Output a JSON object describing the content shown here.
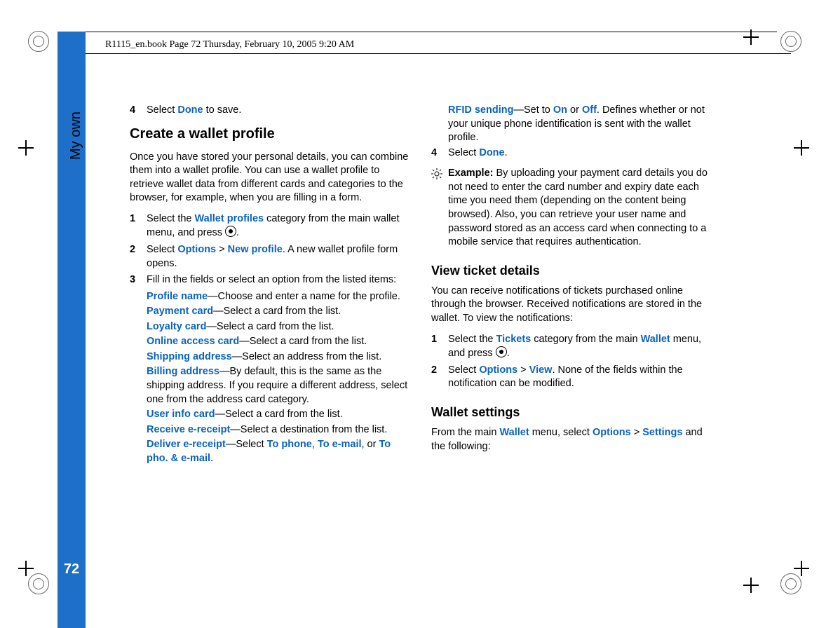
{
  "meta": {
    "header": "R1115_en.book  Page 72  Thursday, February 10, 2005  9:20 AM",
    "sideLabel": "My own",
    "pageNumber": "72"
  },
  "left": {
    "s4": {
      "num": "4",
      "pre": "Select ",
      "term": "Done",
      "post": " to save."
    },
    "h3": "Create a wallet profile",
    "intro": "Once you have stored your personal details, you can combine them into a wallet profile. You can use a wallet profile to retrieve wallet data from different cards and categories to the browser, for example, when you are filling in a form.",
    "steps": {
      "1": {
        "num": "1",
        "pre": "Select the ",
        "term": "Wallet profiles",
        "post": " category from the main wallet menu, and press "
      },
      "2": {
        "num": "2",
        "pre": "Select ",
        "t1": "Options",
        "sep": " > ",
        "t2": "New profile",
        "post": ". A new wallet profile form opens."
      },
      "3": {
        "num": "3",
        "text": "Fill in the fields or select an option from the listed items:"
      }
    },
    "defs": {
      "profileName": {
        "term": "Profile name",
        "desc": "—Choose and enter a name for the profile."
      },
      "payment": {
        "term": "Payment card",
        "desc": "—Select a card from the list."
      },
      "loyalty": {
        "term": "Loyalty card",
        "desc": "—Select a card from the list."
      },
      "online": {
        "term": "Online access card",
        "desc": "—Select a card from the list."
      },
      "shipping": {
        "term": "Shipping address",
        "desc": "—Select an address from the list."
      },
      "billing": {
        "term": "Billing address",
        "desc": "—By default, this is the same as the shipping address. If you require a different address, select one from the address card category."
      },
      "userinfo": {
        "term": "User info card",
        "desc": "—Select a card from the list."
      },
      "recvE": {
        "term": "Receive e-receipt",
        "desc": "—Select a destination from the list."
      },
      "delivE": {
        "term": "Deliver e-receipt",
        "pre": "—Select ",
        "o1": "To phone",
        "c1": ", ",
        "o2": "To e-mail",
        "c2": ", or ",
        "o3": "To pho. & e-mail",
        "post": "."
      }
    }
  },
  "right": {
    "rfid": {
      "term": "RFID sending",
      "pre": "—Set to ",
      "on": "On",
      "or": " or ",
      "off": "Off",
      "post": ". Defines whether or not your unique phone identification is sent with the wallet profile."
    },
    "s4": {
      "num": "4",
      "pre": "Select ",
      "term": "Done",
      "post": "."
    },
    "example": {
      "label": "Example:",
      "text": " By uploading your payment card details you do not need to enter the card number and expiry date each time you need them (depending on the content being browsed). Also, you can retrieve your user name and password stored as an access card when connecting to a mobile service that requires authentication."
    },
    "h4a": "View ticket details",
    "ticketsIntro": "You can receive notifications of tickets purchased online through the browser. Received notifications are stored in the wallet. To view the notifications:",
    "tsteps": {
      "1": {
        "num": "1",
        "pre": "Select the ",
        "t1": "Tickets",
        "mid": " category from the main ",
        "t2": "Wallet",
        "post": " menu, and press "
      },
      "2": {
        "num": "2",
        "pre": "Select ",
        "t1": "Options",
        "sep": " > ",
        "t2": "View",
        "post": ". None of the fields within the notification can be modified."
      }
    },
    "h4b": "Wallet settings",
    "wsIntro": {
      "pre": "From the main ",
      "t1": "Wallet",
      "mid": " menu, select ",
      "t2": "Options",
      "sep": " > ",
      "t3": "Settings",
      "post": " and the following:"
    }
  }
}
